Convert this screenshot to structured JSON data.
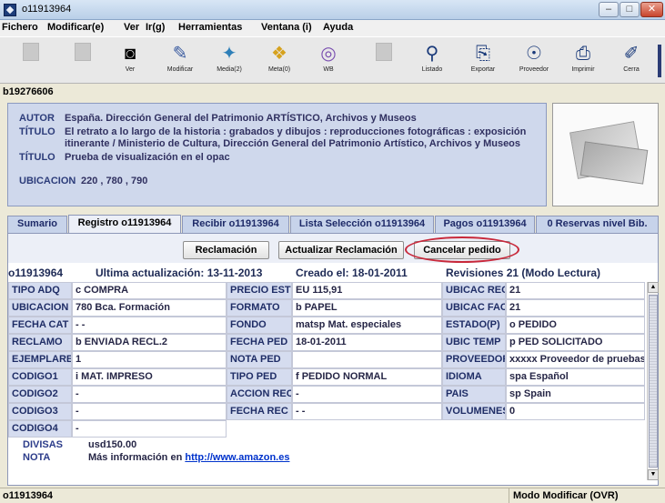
{
  "window": {
    "title": "o11913964",
    "min": "–",
    "max": "□",
    "close": "✕"
  },
  "menu": [
    {
      "label": "Fichero"
    },
    {
      "label": "Modificar(e)"
    },
    {
      "label": "Ver"
    },
    {
      "label": "Ir(g)"
    },
    {
      "label": "Herramientas"
    },
    {
      "label": "Ventana (i)"
    },
    {
      "label": "Ayuda"
    }
  ],
  "toolbar": [
    {
      "label": "",
      "icon": "new-record-icon",
      "enabled": false
    },
    {
      "label": "",
      "icon": "save-icon",
      "enabled": false
    },
    {
      "label": "Ver",
      "icon": "view-icon",
      "glyph": "◙",
      "enabled": true
    },
    {
      "label": "Modificar",
      "icon": "edit-icon",
      "glyph": "✎",
      "enabled": true
    },
    {
      "label": "Media(2)",
      "icon": "media-icon",
      "glyph": "✦",
      "enabled": true
    },
    {
      "label": "Meta(0)",
      "icon": "meta-icon",
      "glyph": "❖",
      "enabled": true
    },
    {
      "label": "WB",
      "icon": "web-icon",
      "glyph": "◎",
      "enabled": true
    },
    {
      "label": "",
      "icon": "disabled-icon",
      "enabled": false
    },
    {
      "label": "Listado",
      "icon": "search-icon",
      "glyph": "⚲",
      "enabled": true
    },
    {
      "label": "Exportar",
      "icon": "export-icon",
      "glyph": "⎘",
      "enabled": true
    },
    {
      "label": "Proveedor",
      "icon": "provider-icon",
      "glyph": "☉",
      "enabled": true
    },
    {
      "label": "Imprimir",
      "icon": "print-icon",
      "glyph": "⎙",
      "enabled": true
    },
    {
      "label": "Cerra",
      "icon": "close-record-icon",
      "glyph": "✐",
      "enabled": true
    }
  ],
  "record": {
    "bib_id": "b19276606",
    "autor_label": "AUTOR",
    "autor": "España. Dirección General del Patrimonio ARTÍSTICO, Archivos y Museos",
    "titulo_label": "TÍTULO",
    "titulo1_line1": "El retrato a lo largo de la historia : grabados y dibujos : reproducciones fotográficas : exposición",
    "titulo1_line2": "itinerante / Ministerio de Cultura, Dirección General del Patrimonio Artístico, Archivos y Museos",
    "titulo2": "Prueba de visualización en el opac",
    "ubicacion_label": "UBICACION",
    "ubicacion": "220 , 780 , 790"
  },
  "tabs": [
    {
      "label": "Sumario"
    },
    {
      "label": "Registro o11913964"
    },
    {
      "label": "Recibir o11913964"
    },
    {
      "label": "Lista Selección o11913964"
    },
    {
      "label": "Pagos o11913964"
    },
    {
      "label": "0 Reservas nivel Bib."
    }
  ],
  "actions": {
    "reclamacion": "Reclamación",
    "actualizar": "Actualizar Reclamación",
    "cancelar": "Cancelar pedido"
  },
  "info": {
    "id": "o11913964",
    "updated": "Ultima actualización: 13-11-2013",
    "created": "Creado el: 18-01-2011",
    "revisions": "Revisiones 21 (Modo Lectura)"
  },
  "fields": {
    "col1": [
      {
        "label": "TIPO ADQ",
        "value": "c  COMPRA"
      },
      {
        "label": "UBICACION",
        "value": "780   Bca. Formación"
      },
      {
        "label": "FECHA CAT",
        "value": "- -"
      },
      {
        "label": "RECLAMO",
        "value": "b  ENVIADA RECL.2"
      },
      {
        "label": "EJEMPLARES",
        "value": "1"
      },
      {
        "label": "CODIGO1",
        "value": "i   MAT. IMPRESO"
      },
      {
        "label": "CODIGO2",
        "value": "-"
      },
      {
        "label": "CODIGO3",
        "value": "-"
      },
      {
        "label": "CODIGO4",
        "value": "-"
      }
    ],
    "col2": [
      {
        "label": "PRECIO EST",
        "value": "EU 115,91"
      },
      {
        "label": "FORMATO",
        "value": "b  PAPEL"
      },
      {
        "label": "FONDO",
        "value": "matsp  Mat. especiales"
      },
      {
        "label": "FECHA PED",
        "value": "18-01-2011"
      },
      {
        "label": "NOTA PED",
        "value": ""
      },
      {
        "label": "TIPO PED",
        "value": "f   PEDIDO NORMAL"
      },
      {
        "label": "ACCION REC",
        "value": "-"
      },
      {
        "label": "FECHA REC",
        "value": "- -"
      }
    ],
    "col3": [
      {
        "label": "UBICAC REC",
        "value": "21"
      },
      {
        "label": "UBICAC FAC",
        "value": "21"
      },
      {
        "label": "ESTADO(P)",
        "value": "o  PEDIDO"
      },
      {
        "label": "UBIC TEMP",
        "value": "p  PED SOLICITADO"
      },
      {
        "label": "PROVEEDOR",
        "value": "xxxxx  Proveedor de pruebas"
      },
      {
        "label": "IDIOMA",
        "value": "spa  Español"
      },
      {
        "label": "PAIS",
        "value": "sp   Spain"
      },
      {
        "label": "VOLUMENES",
        "value": "0"
      }
    ]
  },
  "extra": {
    "divisas_label": "DIVISAS",
    "divisas": "usd150.00",
    "nota_label": "NOTA",
    "nota_text": "Más información en ",
    "nota_link": "http://www.amazon.es"
  },
  "status": {
    "left": "o11913964",
    "mode": "Modo Modificar (OVR)"
  },
  "colors": {
    "highlight": "#c8283a",
    "tab_bg": "#c7d3ea",
    "label_bg": "#d5dcef"
  }
}
